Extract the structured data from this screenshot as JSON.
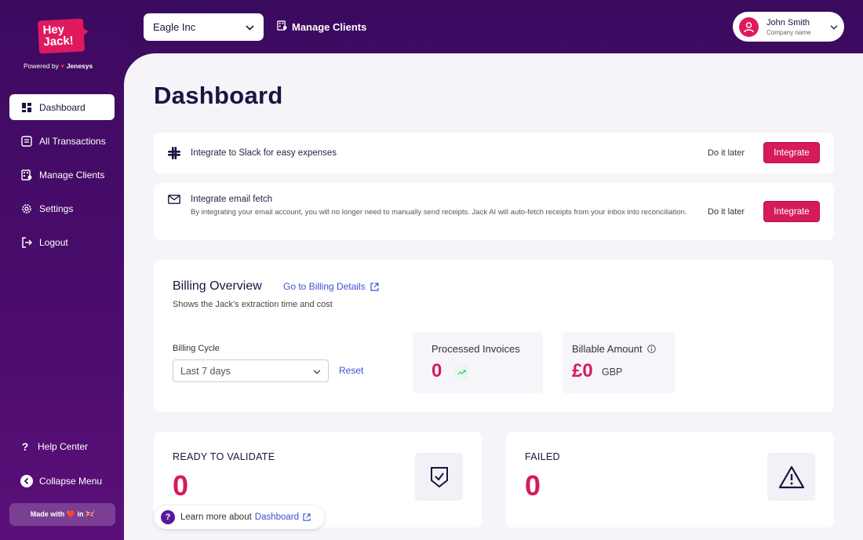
{
  "brand": {
    "logo_text": "Hey Jack!",
    "powered_by": "Powered by",
    "powered_company": "Jenesys",
    "accent": "#e0195f",
    "sidebar_bg": "#4a0c6c"
  },
  "sidebar": {
    "items": [
      {
        "label": "Dashboard",
        "icon": "dashboard-icon"
      },
      {
        "label": "All Transactions",
        "icon": "transactions-icon"
      },
      {
        "label": "Manage Clients",
        "icon": "clients-icon"
      },
      {
        "label": "Settings",
        "icon": "gear-icon"
      },
      {
        "label": "Logout",
        "icon": "logout-icon"
      }
    ],
    "help": "Help Center",
    "collapse": "Collapse Menu",
    "made_with": "Made with ❤️ in 🇬🇧"
  },
  "topbar": {
    "company": "Eagle Inc",
    "manage_clients": "Manage Clients",
    "user_name": "John Smith",
    "user_company": "Company name"
  },
  "main": {
    "title": "Dashboard",
    "integrations": [
      {
        "title": "Integrate to Slack for easy expenses",
        "description": "",
        "later": "Do it later",
        "action": "Integrate"
      },
      {
        "title": "Integrate email fetch",
        "description": "By integrating your email account, you will no longer need to manually send receipts. Jack AI will auto-fetch receipts from your inbox into reconciliation.",
        "later": "Do it later",
        "action": "Integrate"
      }
    ],
    "billing": {
      "title": "Billing Overview",
      "link": "Go to Billing Details",
      "subtitle": "Shows the Jack's extraction time and cost",
      "cycle_label": "Billing Cycle",
      "cycle_value": "Last 7 days",
      "reset": "Reset",
      "processed_label": "Processed Invoices",
      "processed_value": "0",
      "billable_label": "Billable Amount",
      "billable_value": "£0",
      "billable_currency": "GBP"
    },
    "ready": {
      "title": "READY TO VALIDATE",
      "value": "0"
    },
    "failed": {
      "title": "FAILED",
      "value": "0"
    },
    "learn": {
      "text": "Learn more about",
      "link": "Dashboard"
    }
  }
}
